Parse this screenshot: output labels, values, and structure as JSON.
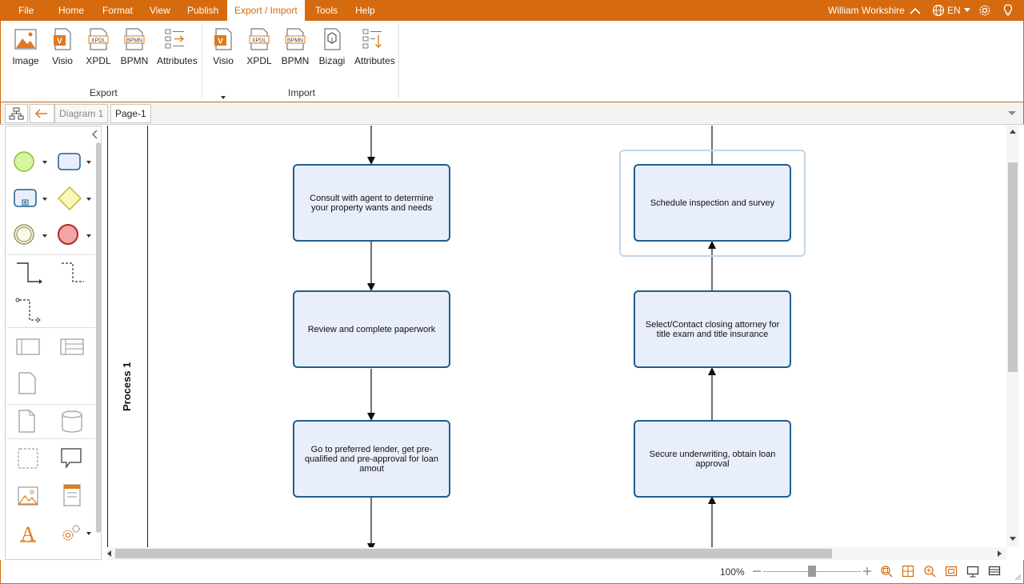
{
  "menu": {
    "items": [
      {
        "label": "File"
      },
      {
        "label": "Home"
      },
      {
        "label": "Format"
      },
      {
        "label": "View"
      },
      {
        "label": "Publish"
      },
      {
        "label": "Export / Import"
      },
      {
        "label": "Tools"
      },
      {
        "label": "Help"
      }
    ],
    "active_index": 5,
    "user_name": "William Workshire",
    "language": "EN"
  },
  "ribbon": {
    "export": {
      "label": "Export",
      "buttons": [
        {
          "label": "Image",
          "icon": "image-export-icon"
        },
        {
          "label": "Visio",
          "icon": "visio-icon"
        },
        {
          "label": "XPDL",
          "icon": "xpdl-icon"
        },
        {
          "label": "BPMN",
          "icon": "bpmn-icon"
        },
        {
          "label": "Attributes",
          "icon": "attributes-export-icon"
        }
      ]
    },
    "import": {
      "label": "Import",
      "buttons": [
        {
          "label": "Visio",
          "icon": "visio-icon",
          "has_dropdown": true
        },
        {
          "label": "XPDL",
          "icon": "xpdl-icon"
        },
        {
          "label": "BPMN",
          "icon": "bpmn-icon"
        },
        {
          "label": "Bizagi",
          "icon": "bizagi-icon"
        },
        {
          "label": "Attributes",
          "icon": "attributes-import-icon"
        }
      ]
    },
    "icon_text": {
      "visio": "V",
      "xpdl": "XPDL",
      "bpmn": "BPMN"
    }
  },
  "tabbar": {
    "breadcrumb": [
      "Diagram 1",
      "Page-1"
    ]
  },
  "diagram": {
    "lane_label": "Process 1",
    "tasks": [
      {
        "text": "Consult with agent to determine your property wants and needs"
      },
      {
        "text": "Review and complete paperwork"
      },
      {
        "text": "Go to preferred lender, get pre-qualified and pre-approval for loan amout"
      },
      {
        "text": "Schedule inspection and survey",
        "selected": true
      },
      {
        "text": "Select/Contact closing attorney for title exam and title insurance"
      },
      {
        "text": "Secure underwriting, obtain loan approval"
      }
    ]
  },
  "statusbar": {
    "zoom": "100%",
    "zoom_level": 0.5
  },
  "colors": {
    "accent": "#d56a0e",
    "task_fill": "#e9eefb",
    "task_border": "#1f5e8e",
    "selection": "#c4d6e6"
  }
}
